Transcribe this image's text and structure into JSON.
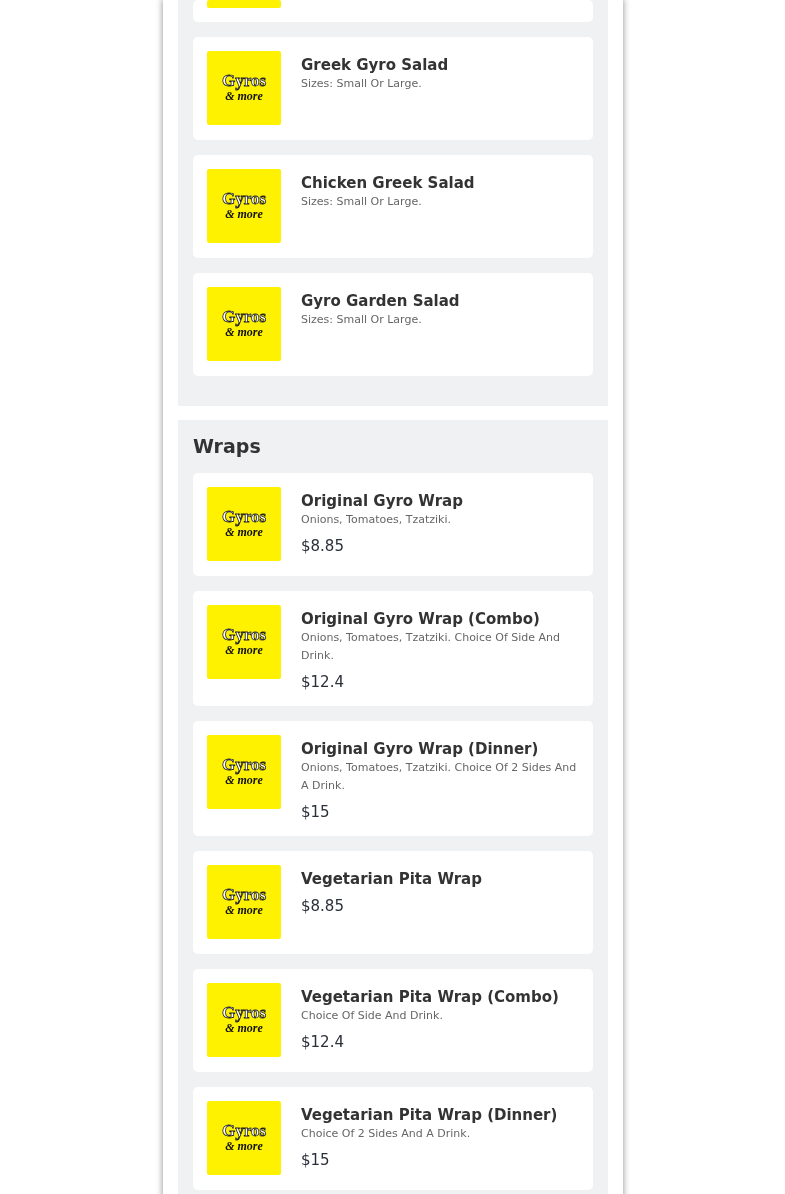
{
  "sections": [
    {
      "items": [
        {
          "kind": "cut_off"
        },
        {
          "kind": "item",
          "logo": {
            "wordmark": "Gyros",
            "tagline": "& more"
          },
          "name": "Greek Gyro Salad",
          "description": "Sizes: Small Or Large."
        },
        {
          "kind": "item",
          "logo": {
            "wordmark": "Gyros",
            "tagline": "& more"
          },
          "name": "Chicken Greek Salad",
          "description": "Sizes: Small Or Large."
        },
        {
          "kind": "item",
          "logo": {
            "wordmark": "Gyros",
            "tagline": "& more"
          },
          "name": "Gyro Garden Salad",
          "description": "Sizes: Small Or Large."
        }
      ]
    },
    {
      "heading": "Wraps",
      "items": [
        {
          "kind": "item",
          "logo": {
            "wordmark": "Gyros",
            "tagline": "& more"
          },
          "name": "Original Gyro Wrap",
          "description": "Onions, Tomatoes, Tzatziki.",
          "price": "$8.85"
        },
        {
          "kind": "item",
          "logo": {
            "wordmark": "Gyros",
            "tagline": "& more"
          },
          "name": "Original Gyro Wrap (Combo)",
          "description": "Onions, Tomatoes, Tzatziki. Choice Of Side And Drink.",
          "price": "$12.4"
        },
        {
          "kind": "item",
          "logo": {
            "wordmark": "Gyros",
            "tagline": "& more"
          },
          "name": "Original Gyro Wrap (Dinner)",
          "description": "Onions, Tomatoes, Tzatziki. Choice Of 2 Sides And A Drink.",
          "price": "$15"
        },
        {
          "kind": "item",
          "logo": {
            "wordmark": "Gyros",
            "tagline": "& more"
          },
          "name": "Vegetarian Pita Wrap",
          "price": "$8.85"
        },
        {
          "kind": "item",
          "logo": {
            "wordmark": "Gyros",
            "tagline": "& more"
          },
          "name": "Vegetarian Pita Wrap (Combo)",
          "description": "Choice Of Side And Drink.",
          "price": "$12.4"
        },
        {
          "kind": "item",
          "logo": {
            "wordmark": "Gyros",
            "tagline": "& more"
          },
          "name": "Vegetarian Pita Wrap (Dinner)",
          "description": "Choice Of 2 Sides And A Drink.",
          "price": "$15"
        }
      ]
    }
  ]
}
